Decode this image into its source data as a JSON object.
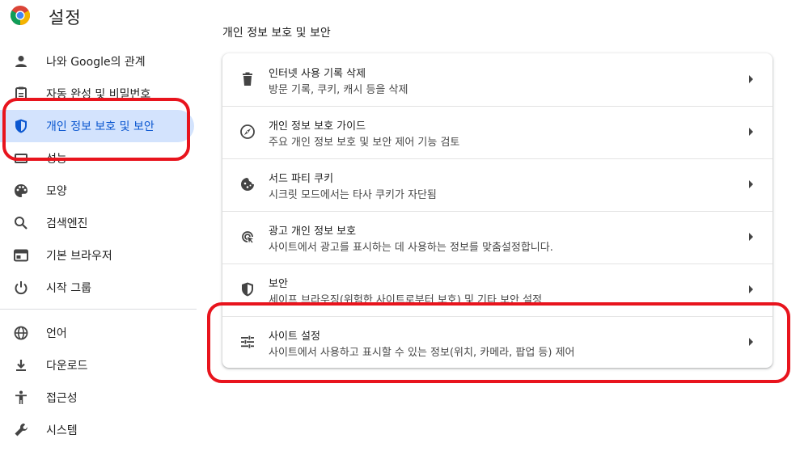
{
  "header": {
    "title": "설정"
  },
  "sidebar": {
    "items": [
      {
        "label": "나와 Google의 관계",
        "icon": "person-icon"
      },
      {
        "label": "자동 완성 및 비밀번호",
        "icon": "clipboard-icon"
      },
      {
        "label": "개인 정보 보호 및 보안",
        "icon": "shield-icon",
        "active": true
      },
      {
        "label": "성능",
        "icon": "speed-icon"
      },
      {
        "label": "모양",
        "icon": "palette-icon"
      },
      {
        "label": "검색엔진",
        "icon": "search-icon"
      },
      {
        "label": "기본 브라우저",
        "icon": "browser-icon"
      },
      {
        "label": "시작 그룹",
        "icon": "power-icon"
      },
      {
        "label": "언어",
        "icon": "globe-icon"
      },
      {
        "label": "다운로드",
        "icon": "download-icon"
      },
      {
        "label": "접근성",
        "icon": "accessibility-icon"
      },
      {
        "label": "시스템",
        "icon": "wrench-icon"
      }
    ]
  },
  "main": {
    "section_title": "개인 정보 보호 및 보안",
    "rows": [
      {
        "title": "인터넷 사용 기록 삭제",
        "subtitle": "방문 기록, 쿠키, 캐시 등을 삭제",
        "icon": "trash-icon"
      },
      {
        "title": "개인 정보 보호 가이드",
        "subtitle": "주요 개인 정보 보호 및 보안 제어 기능 검토",
        "icon": "compass-icon"
      },
      {
        "title": "서드 파티 쿠키",
        "subtitle": "시크릿 모드에서는 타사 쿠키가 자단됨",
        "icon": "cookie-icon"
      },
      {
        "title": "광고 개인 정보 보호",
        "subtitle": "사이트에서 광고를 표시하는 데 사용하는 정보를 맞춤설정합니다.",
        "icon": "ad-privacy-icon"
      },
      {
        "title": "보안",
        "subtitle": "세이프 브라우징(위험한 사이트로부터 보호) 및 기타 보안 설정",
        "icon": "security-shield-icon"
      },
      {
        "title": "사이트 설정",
        "subtitle": "사이트에서 사용하고 표시할 수 있는 정보(위치, 카메라, 팝업 등) 제어",
        "icon": "tune-icon"
      }
    ]
  },
  "colors": {
    "accent": "#0b57d0",
    "active_bg": "#d3e3fd",
    "annotation": "#e8141d"
  }
}
